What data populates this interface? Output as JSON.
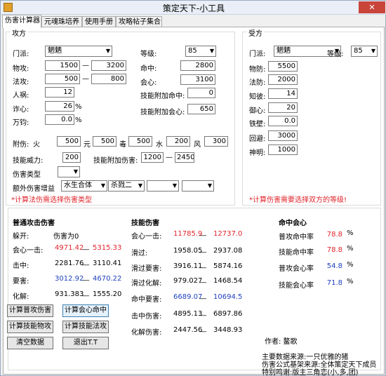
{
  "window": {
    "title": "策定天下-小工具",
    "close_label": "✕"
  },
  "tabs": [
    {
      "label": "伤害计算器",
      "active": true
    },
    {
      "label": "元魂珠培养",
      "active": false
    },
    {
      "label": "使用手册",
      "active": false
    },
    {
      "label": "攻略帖子集合",
      "active": false
    }
  ],
  "attacker": {
    "title": "攻方",
    "sect_label": "门派:",
    "sect_value": "魍魉",
    "level_label": "等级:",
    "level_value": "85",
    "phys_atk_label": "物攻:",
    "phys_atk_min": "1500",
    "phys_atk_max": "3200",
    "mag_atk_label": "法攻:",
    "mag_atk_min": "500",
    "mag_atk_max": "800",
    "luck_label": "人祸:",
    "luck_value": "12",
    "crit_label": "诈心:",
    "crit_value": "26",
    "ignore_label": "万钧:",
    "ignore_value": "0.0",
    "hit_label": "命中:",
    "hit_value": "2800",
    "crit_rate_label": "会心:",
    "crit_rate_value": "3100",
    "skill_hit_label": "技能附加命中:",
    "skill_hit_value": "0",
    "skill_crit_label": "技能附加会心:",
    "skill_crit_value": "650",
    "percent_sign": "%",
    "dash": "—",
    "extra_label": "附伤:",
    "fire_label": "火",
    "fire_value": "500",
    "yuan_label": "元",
    "yuan_value": "500",
    "poison_label": "毒",
    "poison_value": "500",
    "water_label": "水",
    "water_value": "200",
    "wind_label": "风",
    "wind_value": "300",
    "skill_power_label": "技能威力:",
    "skill_power_value": "200",
    "skill_extra_label": "技能附加伤害:",
    "skill_extra_min": "1200",
    "skill_extra_max": "2450",
    "dmg_type_label": "伤害类型",
    "dmg_type_value": "",
    "bonus_label": "额外伤害增益",
    "bonus_1": "水生合体",
    "bonus_2": "杀戮二",
    "bonus_3": "",
    "bonus_4": "",
    "warning": "*计算法伤需选择伤害类型"
  },
  "defender": {
    "title": "受方",
    "sect_label": "门派:",
    "sect_value": "魍魉",
    "level_label": "等级:",
    "level_value": "85",
    "phys_def_label": "物防:",
    "phys_def_value": "5500",
    "mag_def_label": "法防:",
    "mag_def_value": "2000",
    "wisdom_label": "知彼:",
    "wisdom_value": "14",
    "resist_label": "御心:",
    "resist_value": "20",
    "iron_label": "铁壁:",
    "iron_value": "0.0",
    "dodge_label": "回避:",
    "dodge_value": "3000",
    "clarity_label": "神明:",
    "clarity_value": "1000",
    "warning": "*计算伤害需要选择双方的等级!"
  },
  "results": {
    "normal_title": "普通攻击伤害",
    "skill_title": "技能伤害",
    "hit_title": "命中会心",
    "dash": "__",
    "parry_label": "躲开:",
    "parry_value": "伤害为0",
    "normal": [
      {
        "label": "会心一击:",
        "min": "4971.42",
        "max": "5315.33",
        "color": "red"
      },
      {
        "label": "击中:",
        "min": "2281.76",
        "max": "3110.41",
        "color": "black"
      },
      {
        "label": "要害:",
        "min": "3012.92",
        "max": "4670.22",
        "color": "blue"
      },
      {
        "label": "化解:",
        "min": "931.383",
        "max": "1555.20",
        "color": "black"
      }
    ],
    "skill": [
      {
        "label": "会心一击:",
        "min": "11785.9",
        "max": "12737.0",
        "color": "red"
      },
      {
        "label": "滑过:",
        "min": "1958.05",
        "max": "2937.08",
        "color": "black"
      },
      {
        "label": "滑过要害:",
        "min": "3916.11",
        "max": "5874.16",
        "color": "black"
      },
      {
        "label": "滑过化解:",
        "min": "979.027",
        "max": "1468.54",
        "color": "black"
      },
      {
        "label": "命中要害:",
        "min": "6689.07",
        "max": "10694.5",
        "color": "blue"
      },
      {
        "label": "击中伤害:",
        "min": "4895.13",
        "max": "6897.86",
        "color": "black"
      },
      {
        "label": "化解伤害:",
        "min": "2447.56",
        "max": "3448.93",
        "color": "black"
      }
    ],
    "rates": [
      {
        "label": "普攻命中率",
        "value": "78.8",
        "color": "red"
      },
      {
        "label": "技能命中率",
        "value": "78.8",
        "color": "red"
      },
      {
        "label": "普攻会心率",
        "value": "54.8",
        "color": "blue"
      },
      {
        "label": "技能会心率",
        "value": "71.8",
        "color": "blue"
      }
    ],
    "percent_sign": "%"
  },
  "buttons": {
    "calc_normal": "计算普攻伤害",
    "calc_crit_hit": "计算会心命中",
    "calc_skill_phys": "计算技能物攻",
    "calc_skill_mag": "计算技能法攻",
    "clear": "清空数据",
    "exit": "退出T.T"
  },
  "footer": {
    "author": "作者: 鳌歌",
    "source_1": "主要数据来源:一只优雅的猪",
    "source_2": "伤害公式基架来源:全体策定天下成员",
    "thanks": "特别鸣谢:版主三角恋(小,多,团)"
  }
}
